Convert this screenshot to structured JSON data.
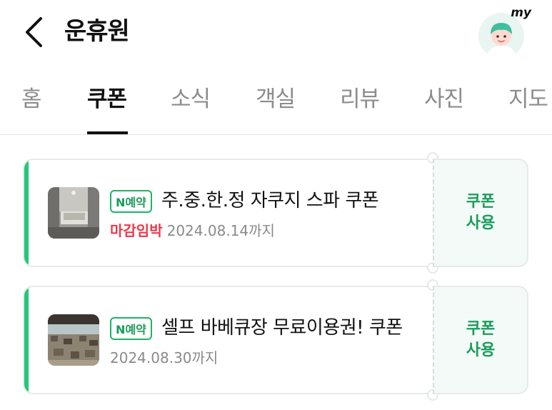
{
  "header": {
    "title": "운휴원",
    "avatar_label": "my"
  },
  "tabs": [
    {
      "label": "홈",
      "active": false
    },
    {
      "label": "쿠폰",
      "active": true
    },
    {
      "label": "소식",
      "active": false
    },
    {
      "label": "객실",
      "active": false
    },
    {
      "label": "리뷰",
      "active": false
    },
    {
      "label": "사진",
      "active": false
    },
    {
      "label": "지도",
      "active": false
    }
  ],
  "coupons": [
    {
      "badge": "N예약",
      "title": "주.중.한.정 자쿠지 스파 쿠폰",
      "deadline_tag": "마감임박",
      "expiry": "2024.08.14까지",
      "action": "쿠폰\n사용"
    },
    {
      "badge": "N예약",
      "title": "셀프 바베큐장 무료이용권! 쿠폰",
      "deadline_tag": "",
      "expiry": "2024.08.30까지",
      "action": "쿠폰\n사용"
    }
  ],
  "colors": {
    "accent_green": "#22c77a",
    "action_green": "#1a9c5c",
    "deadline_red": "#ea3b4a"
  }
}
